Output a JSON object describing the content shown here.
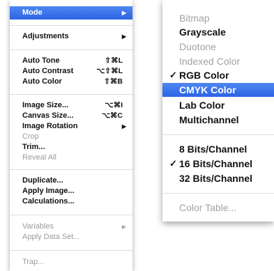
{
  "image_menu": {
    "mode": {
      "label": "Mode",
      "arrow": "▶"
    },
    "adjustments": {
      "label": "Adjustments",
      "arrow": "▶"
    },
    "auto_tone": {
      "label": "Auto Tone",
      "shortcut": "⇧⌘L"
    },
    "auto_contrast": {
      "label": "Auto Contrast",
      "shortcut": "⌥⇧⌘L"
    },
    "auto_color": {
      "label": "Auto Color",
      "shortcut": "⇧⌘B"
    },
    "image_size": {
      "label": "Image Size...",
      "shortcut": "⌥⌘I"
    },
    "canvas_size": {
      "label": "Canvas Size...",
      "shortcut": "⌥⌘C"
    },
    "image_rotation": {
      "label": "Image Rotation",
      "arrow": "▶"
    },
    "crop": {
      "label": "Crop"
    },
    "trim": {
      "label": "Trim..."
    },
    "reveal_all": {
      "label": "Reveal All"
    },
    "duplicate": {
      "label": "Duplicate..."
    },
    "apply_image": {
      "label": "Apply Image..."
    },
    "calculations": {
      "label": "Calculations..."
    },
    "variables": {
      "label": "Variables",
      "arrow": "▶"
    },
    "apply_data_set": {
      "label": "Apply Data Set..."
    },
    "trap": {
      "label": "Trap..."
    }
  },
  "mode_submenu": {
    "bitmap": {
      "label": "Bitmap"
    },
    "grayscale": {
      "label": "Grayscale"
    },
    "duotone": {
      "label": "Duotone"
    },
    "indexed_color": {
      "label": "Indexed Color"
    },
    "rgb_color": {
      "label": "RGB Color",
      "check": "✓"
    },
    "cmyk_color": {
      "label": "CMYK Color"
    },
    "lab_color": {
      "label": "Lab Color"
    },
    "multichannel": {
      "label": "Multichannel"
    },
    "bits_8": {
      "label": "8 Bits/Channel"
    },
    "bits_16": {
      "label": "16 Bits/Channel",
      "check": "✓"
    },
    "bits_32": {
      "label": "32 Bits/Channel"
    },
    "color_table": {
      "label": "Color Table..."
    }
  },
  "colors": {
    "highlight": "#3a73ea",
    "disabled_text": "#9b9b9b",
    "text": "#111111"
  }
}
